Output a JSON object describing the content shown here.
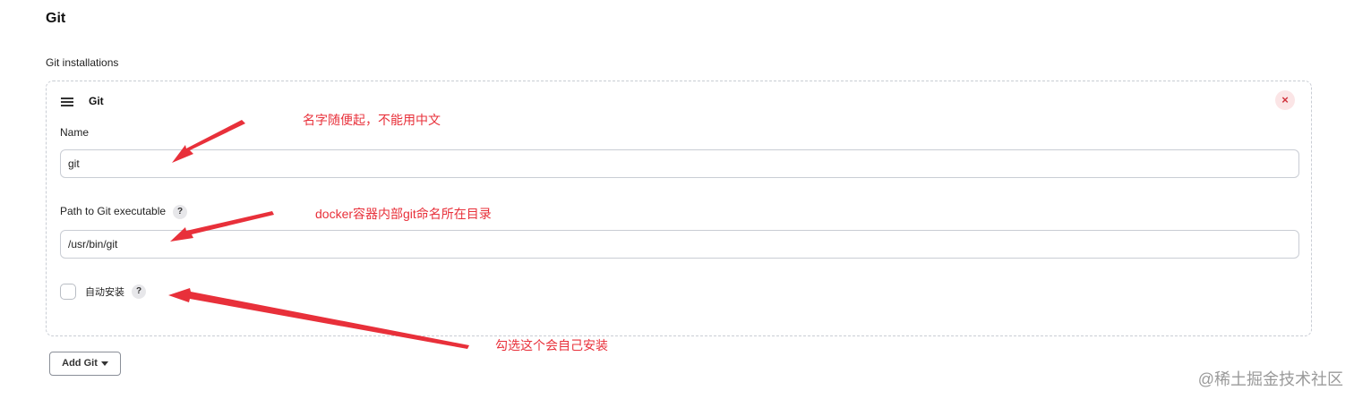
{
  "section": {
    "title": "Git",
    "installations_label": "Git installations"
  },
  "card": {
    "handle_icon": "hamburger-drag-icon",
    "title": "Git",
    "close_icon": "close-icon",
    "close_glyph": "×",
    "name_label": "Name",
    "name_value": "git",
    "path_label": "Path to Git executable",
    "path_help": "?",
    "path_value": "/usr/bin/git",
    "auto_install_label": "自动安装",
    "auto_install_help": "?",
    "auto_install_checked": false
  },
  "add_button": {
    "label": "Add Git",
    "icon": "caret-down-icon"
  },
  "annotations": {
    "name_note": "名字随便起，不能用中文",
    "path_note": "docker容器内部git命名所在目录",
    "auto_install_note": "勾选这个会自己安装",
    "color": "#e8303a"
  },
  "watermark": "@稀土掘金技术社区"
}
